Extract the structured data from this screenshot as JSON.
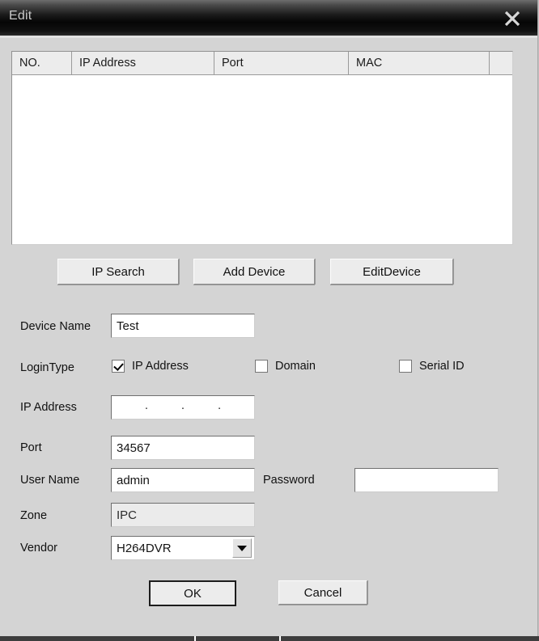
{
  "window": {
    "title": "Edit",
    "close_icon": "close-icon",
    "accent_titlebar": "#0a0a0a",
    "surface": "#d4d4d4"
  },
  "device_list": {
    "columns": [
      "NO.",
      "IP Address",
      "Port",
      "MAC",
      ""
    ],
    "rows": []
  },
  "actions": {
    "ip_search": "IP Search",
    "add_device": "Add Device",
    "edit_device": "EditDevice"
  },
  "form": {
    "device_name": {
      "label": "Device Name",
      "value": "Test"
    },
    "login_type": {
      "label": "LoginType",
      "options": [
        {
          "label": "IP Address",
          "checked": true
        },
        {
          "label": "Domain",
          "checked": false
        },
        {
          "label": "Serial ID",
          "checked": false
        }
      ]
    },
    "ip_address": {
      "label": "IP Address",
      "segments": [
        "",
        "",
        "",
        ""
      ],
      "separator": "."
    },
    "port": {
      "label": "Port",
      "value": "34567"
    },
    "user_name": {
      "label": "User Name",
      "value": "admin"
    },
    "password": {
      "label": "Password",
      "value": ""
    },
    "zone": {
      "label": "Zone",
      "value": "IPC"
    },
    "vendor": {
      "label": "Vendor",
      "value": "H264DVR",
      "arrow_icon": "chevron-down-icon"
    }
  },
  "footer": {
    "ok": "OK",
    "cancel": "Cancel"
  }
}
